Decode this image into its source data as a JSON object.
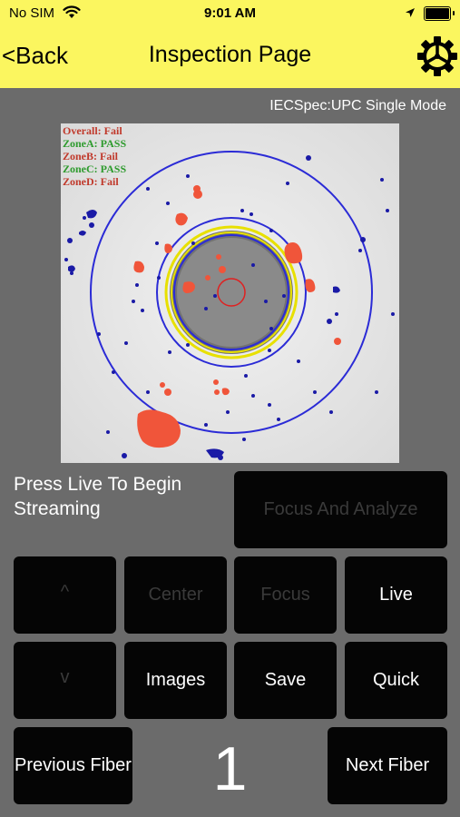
{
  "status_bar": {
    "carrier": "No SIM",
    "time": "9:01 AM"
  },
  "nav": {
    "back_label": "<Back",
    "title": "Inspection Page",
    "settings_icon": "gear-icon"
  },
  "spec_label": "IECSpec:UPC Single Mode",
  "results": {
    "overall": "Overall:  Fail",
    "zone_a": "ZoneA:  PASS",
    "zone_b": "ZoneB:  Fail",
    "zone_c": "ZoneC:  PASS",
    "zone_d": "ZoneD:  Fail"
  },
  "colors": {
    "header": "#fbf65f",
    "background": "#6b6b6b",
    "pass": "#2e9b2e",
    "fail": "#c0392b",
    "zone_ring": "#2b2bd6",
    "core_ring": "#e8e000",
    "defect_red": "#f0553a",
    "defect_blue": "#1a1aa6"
  },
  "prompt": "Press Live To Begin Streaming",
  "buttons": {
    "focus_analyze": "Focus And Analyze",
    "up": "^",
    "center": "Center",
    "focus": "Focus",
    "live": "Live",
    "down": "v",
    "images": "Images",
    "save": "Save",
    "quick": "Quick",
    "previous_fiber": "Previous Fiber",
    "next_fiber": "Next Fiber"
  },
  "fiber_number": "1"
}
